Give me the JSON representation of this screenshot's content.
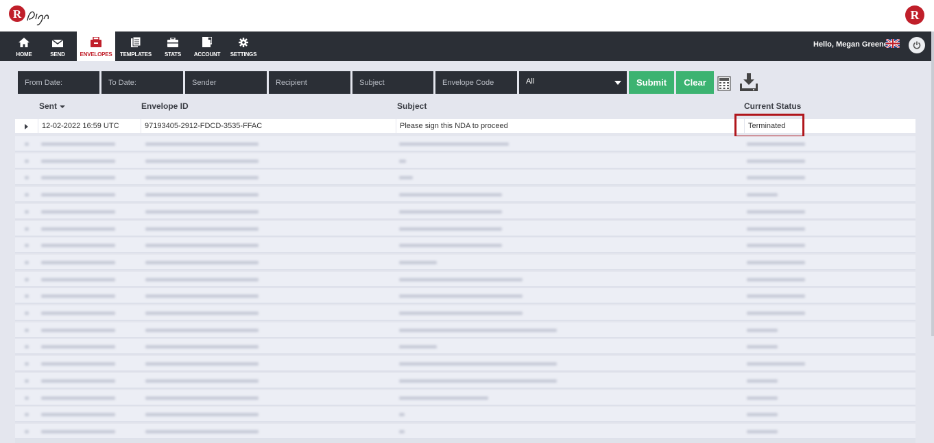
{
  "app": {
    "brand": "RSign",
    "accent": "#c01f2a",
    "success": "#3cb371",
    "dark": "#2b2f36"
  },
  "nav": {
    "items": [
      {
        "label": "HOME",
        "icon": "home-icon"
      },
      {
        "label": "SEND",
        "icon": "envelope-icon"
      },
      {
        "label": "ENVELOPES",
        "icon": "inbox-icon",
        "active": true
      },
      {
        "label": "TEMPLATES",
        "icon": "templates-icon"
      },
      {
        "label": "STATS",
        "icon": "briefcase-icon"
      },
      {
        "label": "ACCOUNT",
        "icon": "account-icon"
      },
      {
        "label": "SETTINGS",
        "icon": "gear-icon"
      }
    ],
    "greeting": "Hello, Megan Greene"
  },
  "filters": {
    "from_date": "From Date:",
    "to_date": "To Date:",
    "sender": "Sender",
    "recipient": "Recipient",
    "subject": "Subject",
    "envelope_code": "Envelope Code",
    "status_selected": "All",
    "submit_label": "Submit",
    "clear_label": "Clear"
  },
  "table": {
    "columns": {
      "sent": "Sent",
      "envelope_id": "Envelope ID",
      "subject": "Subject",
      "status": "Current Status"
    },
    "first_row": {
      "sent": "12-02-2022 16:59 UTC",
      "envelope_id": "97193405-2912-FDCD-3535-FFAC",
      "subject": "Please sign this NDA to proceed",
      "status": "Terminated"
    }
  }
}
